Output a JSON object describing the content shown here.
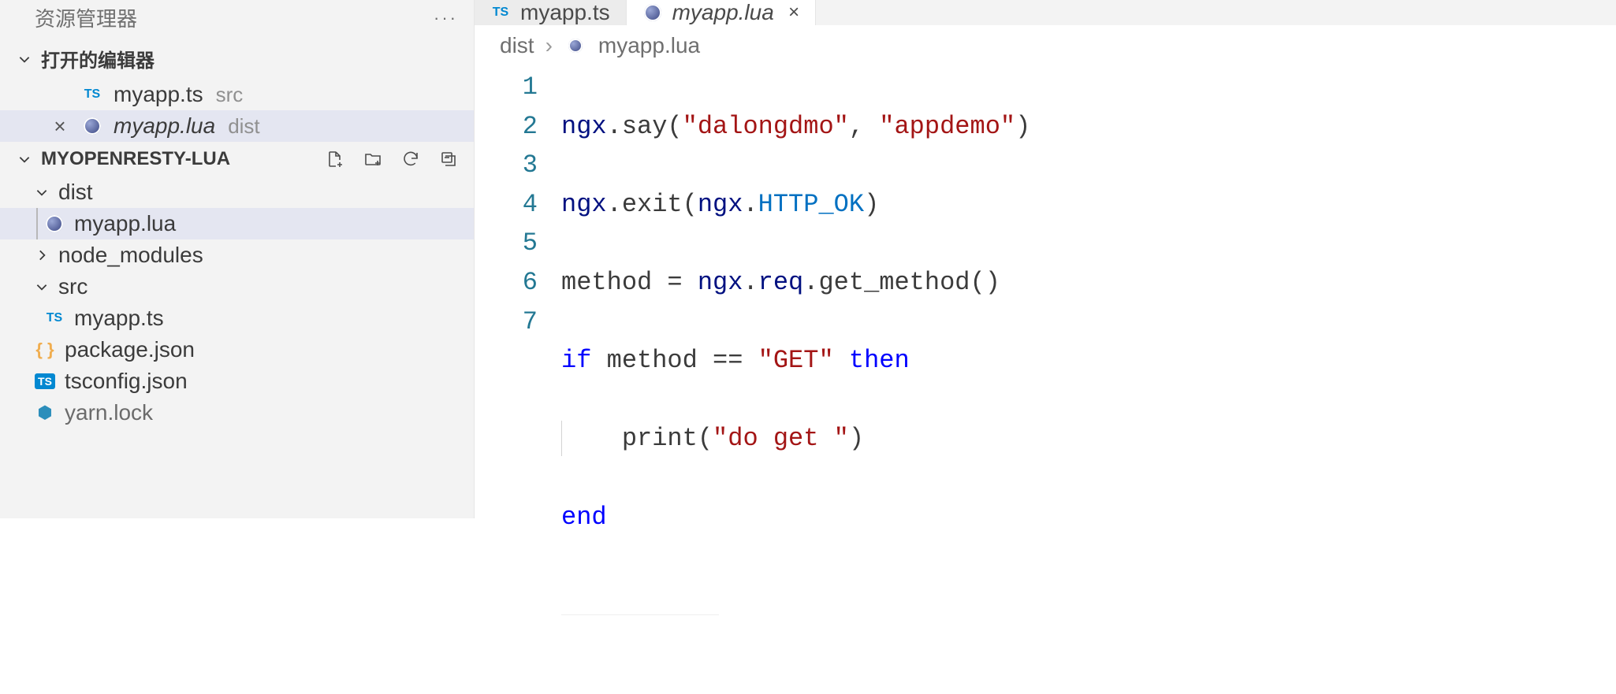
{
  "sidebar": {
    "title": "资源管理器",
    "openEditors": {
      "label": "打开的编辑器",
      "items": [
        {
          "name": "myapp.ts",
          "path": "src",
          "icon": "ts",
          "active": false,
          "italic": false,
          "closeVisible": false
        },
        {
          "name": "myapp.lua",
          "path": "dist",
          "icon": "lua",
          "active": true,
          "italic": true,
          "closeVisible": true
        }
      ]
    },
    "project": {
      "name": "MYOPENRESTY-LUA",
      "tree": [
        {
          "type": "folder",
          "name": "dist",
          "expanded": true,
          "depth": 1
        },
        {
          "type": "file",
          "name": "myapp.lua",
          "icon": "lua",
          "depth": 2,
          "active": true
        },
        {
          "type": "folder",
          "name": "node_modules",
          "expanded": false,
          "depth": 1
        },
        {
          "type": "folder",
          "name": "src",
          "expanded": true,
          "depth": 1
        },
        {
          "type": "file",
          "name": "myapp.ts",
          "icon": "ts",
          "depth": 2
        },
        {
          "type": "file",
          "name": "package.json",
          "icon": "json",
          "depth": 1
        },
        {
          "type": "file",
          "name": "tsconfig.json",
          "icon": "tsfilled",
          "depth": 1
        },
        {
          "type": "file",
          "name": "yarn.lock",
          "icon": "yarn",
          "depth": 1,
          "cut": true
        }
      ]
    }
  },
  "tabs": [
    {
      "name": "myapp.ts",
      "icon": "ts",
      "active": false
    },
    {
      "name": "myapp.lua",
      "icon": "lua",
      "active": true
    }
  ],
  "breadcrumbs": {
    "seg1": "dist",
    "seg2": "myapp.lua"
  },
  "code": {
    "lines": [
      "1",
      "2",
      "3",
      "4",
      "5",
      "6",
      "7"
    ],
    "l1": {
      "a": "ngx",
      "b": ".",
      "c": "say",
      "d": "(",
      "s1": "\"dalongdmo\"",
      "e": ", ",
      "s2": "\"appdemo\"",
      "f": ")"
    },
    "l2": {
      "a": "ngx",
      "b": ".",
      "c": "exit",
      "d": "(",
      "e": "ngx",
      "f": ".",
      "g": "HTTP_OK",
      "h": ")"
    },
    "l3": {
      "a": "method",
      "b": " = ",
      "c": "ngx",
      "d": ".",
      "e": "req",
      "f": ".",
      "g": "get_method",
      "h": "()"
    },
    "l4": {
      "a": "if",
      "b": " method ",
      "c": "==",
      "d": " ",
      "s": "\"GET\"",
      "e": " ",
      "f": "then"
    },
    "l5": {
      "indent": "    ",
      "a": "print",
      "b": "(",
      "s": "\"do get \"",
      "c": ")"
    },
    "l6": {
      "a": "end"
    }
  }
}
